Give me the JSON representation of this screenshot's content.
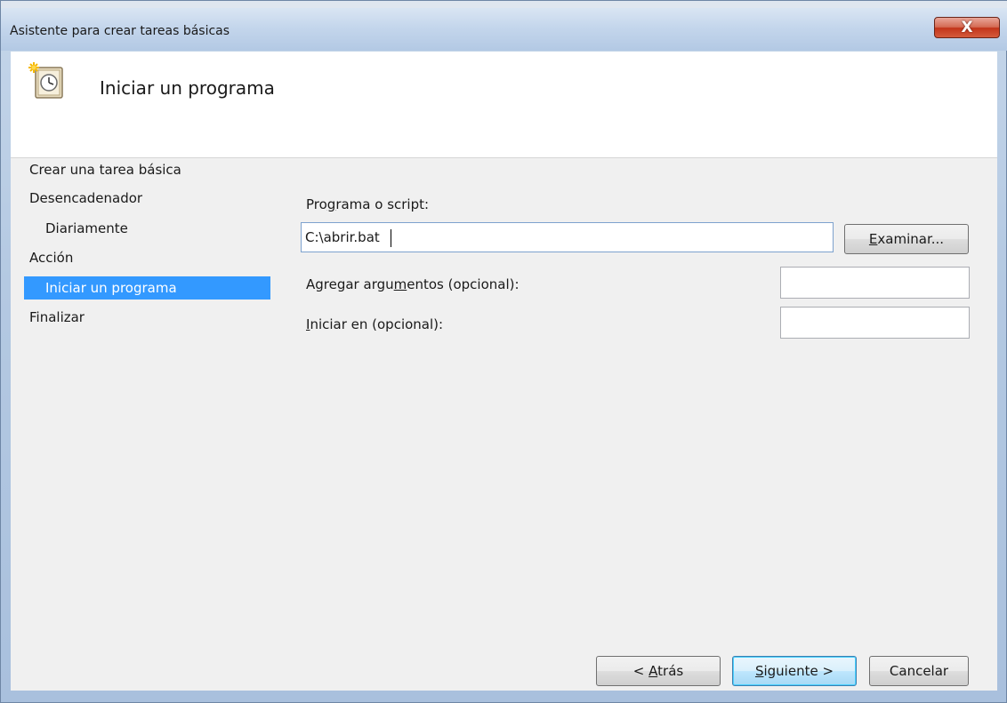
{
  "window": {
    "title": "Asistente para crear tareas básicas",
    "close_label": "X"
  },
  "header": {
    "title": "Iniciar un programa",
    "icon": "task-scheduler-clock-icon"
  },
  "steps": [
    {
      "label": "Crear una tarea básica",
      "selected": false
    },
    {
      "label": "Desencadenador",
      "selected": false
    },
    {
      "label": "Diariamente",
      "selected": false
    },
    {
      "label": "Acción",
      "selected": false
    },
    {
      "label": "Iniciar un programa",
      "selected": true
    },
    {
      "label": "Finalizar",
      "selected": false
    }
  ],
  "form": {
    "program_label_pre": "Pro",
    "program_label_u": "g",
    "program_label_post": "rama o script:",
    "program_value": "C:\\abrir.bat",
    "browse_u": "E",
    "browse_rest": "xaminar...",
    "args_label_pre": "Agregar argu",
    "args_label_u": "m",
    "args_label_post": "entos (opcional):",
    "args_value": "",
    "startin_label_u": "I",
    "startin_label_post": "niciar en (opcional):",
    "startin_value": ""
  },
  "buttons": {
    "back_pre": "< ",
    "back_u": "A",
    "back_post": "trás",
    "next_u": "S",
    "next_post": "iguiente >",
    "cancel": "Cancelar"
  },
  "colors": {
    "selection": "#3399ff",
    "panel": "#f0f0f0",
    "header_bg": "#ffffff"
  }
}
